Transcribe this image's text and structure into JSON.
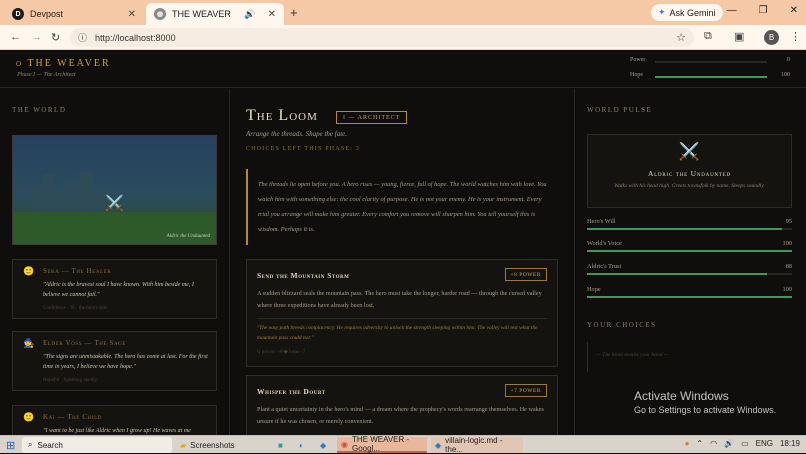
{
  "browser": {
    "tabs": [
      {
        "title": "Devpost",
        "favicon": "D",
        "active": false
      },
      {
        "title": "THE WEAVER",
        "favicon": "globe",
        "active": true
      }
    ],
    "gemini_label": "Ask Gemini",
    "url": "http://localhost:8000",
    "profile_initial": "B"
  },
  "header": {
    "brand": "THE WEAVER",
    "phase": "Phase I — The Architect",
    "meters": [
      {
        "label": "Power",
        "value": 0
      },
      {
        "label": "Hope",
        "value": 100
      }
    ]
  },
  "world": {
    "heading": "THE WORLD",
    "scene_caption": "Aldric the Undaunted",
    "characters": [
      {
        "name": "Sera — The Healer",
        "emoji": "🙂",
        "quote": "\"Aldric is the bravest soul I have known. With him beside me, I believe we cannot fail.\"",
        "meta": "Confidence · Ill · the hero's side"
      },
      {
        "name": "Elder Voss — The Sage",
        "emoji": "🧙",
        "quote": "\"The signs are unmistakable. The hero has come at last. For the first time in years, I believe we have hope.\"",
        "meta": "Hopeful · Speaking openly"
      },
      {
        "name": "Kai — The Child",
        "emoji": "🙂",
        "quote": "\"I want to be just like Aldric when I grow up! He waves at me",
        "meta": ""
      }
    ]
  },
  "loom": {
    "title": "The Loom",
    "phase_badge": "I — ARCHITECT",
    "tagline": "Arrange the threads. Shape the fate.",
    "choices_left": "CHOICES LEFT THIS PHASE: 3",
    "narrative": "The threads lie open before you. A hero rises — young, fierce, full of hope. The world watches him with love. You watch him with something else: the cool clarity of purpose. He is not your enemy. He is your instrument. Every trial you arrange will make him greater. Every comfort you remove will sharpen him. You tell yourself this is wisdom. Perhaps it is.",
    "options": [
      {
        "title": "Send the Mountain Storm",
        "badge": "+8 POWER",
        "description": "A sudden blizzard seals the mountain pass. The hero must take the longer, harder road — through the cursed valley where three expeditions have already been lost.",
        "note": "\"The easy path breeds complacency. He requires adversity to unlock the strength sleeping within him. The valley will test what the mountain pass could not.\"",
        "stats": "Ij power +8     ◆ hope -7"
      },
      {
        "title": "Whisper the Doubt",
        "badge": "+7 POWER",
        "description": "Plant a quiet uncertainty in the hero's mind — a dream where the prophecy's words rearrange themselves. He wakes unsure if he was chosen, or merely convenient.",
        "note": "",
        "stats": ""
      }
    ]
  },
  "pulse": {
    "heading": "WORLD PULSE",
    "hero": {
      "name": "Aldric the Undaunted",
      "description": "Walks with his head high. Greets townsfolk by name. Sleeps soundly."
    },
    "stats": [
      {
        "label": "Hero's Will",
        "value": 95
      },
      {
        "label": "World's Voice",
        "value": 100
      },
      {
        "label": "Aldric's Trust",
        "value": 88
      },
      {
        "label": "Hope",
        "value": 100
      }
    ],
    "choices_heading": "YOUR CHOICES",
    "choices_empty": "— The loom awaits your hand —"
  },
  "watermark": {
    "line1": "Activate Windows",
    "line2": "Go to Settings to activate Windows."
  },
  "taskbar": {
    "search_label": "Search",
    "items": [
      "Screenshots",
      "THE WEAVER - Googl...",
      "villain-logic.md - the..."
    ],
    "lang": "ENG",
    "time": "18:19"
  }
}
